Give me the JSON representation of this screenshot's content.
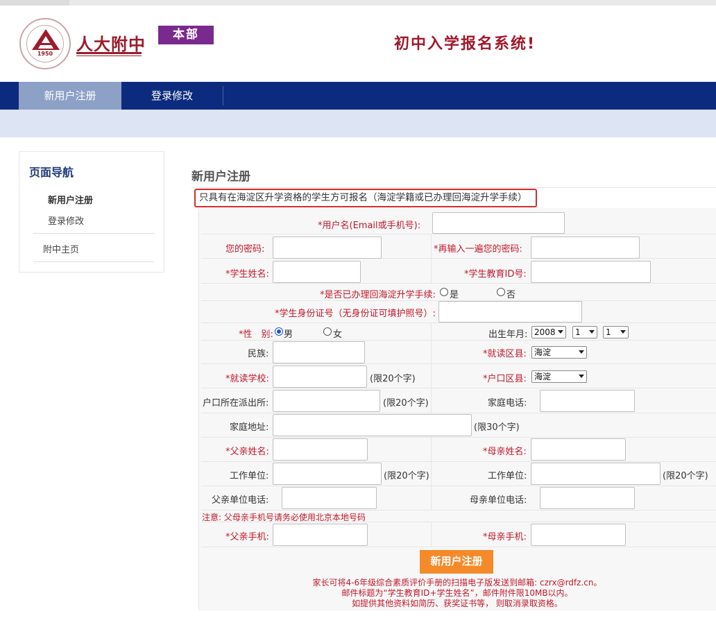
{
  "header": {
    "school_name": "人大附中",
    "seal_year": "1950",
    "campus": "本部",
    "site_title": "初中入学报名系统!"
  },
  "nav": {
    "tabs": [
      {
        "label": "新用户注册",
        "active": true
      },
      {
        "label": "登录修改",
        "active": false
      }
    ]
  },
  "sidebar": {
    "title": "页面导航",
    "items": [
      "新用户注册",
      "登录修改",
      "附中主页"
    ]
  },
  "main": {
    "title": "新用户注册",
    "notice": "只具有在海淀区升学资格的学生方可报名（海淀学籍或已办理回海淀升学手续）"
  },
  "form": {
    "username_label": "*用户名(Email或手机号):",
    "password_label": "您的密码:",
    "password2_label": "*再输入一遍您的密码:",
    "student_name_label": "*学生姓名:",
    "student_id_label": "*学生教育ID号:",
    "transfer_label": "*是否已办理回海淀升学手续:",
    "transfer_yes": "是",
    "transfer_no": "否",
    "idcard_label": "*学生身份证号（无身份证可填护照号）:",
    "gender_label": "*性　别:",
    "gender_male": "男",
    "gender_female": "女",
    "birth_label": "出生年月:",
    "birth_year": "2008",
    "birth_month": "1",
    "birth_day": "1",
    "ethnicity_label": "民族:",
    "district_label": "*就读区县:",
    "district_value": "海淀",
    "school_label": "*就读学校:",
    "limit20": "(限20个字)",
    "hukou_label": "*户口区县:",
    "hukou_value": "海淀",
    "police_label": "户口所在派出所:",
    "home_phone_label": "家庭电话:",
    "address_label": "家庭地址:",
    "limit30": "(限30个字)",
    "father_name_label": "*父亲姓名:",
    "mother_name_label": "*母亲姓名:",
    "work_label": "工作单位:",
    "father_work_phone_label": "父亲单位电话:",
    "mother_work_phone_label": "母亲单位电话:",
    "mobile_note": "注意: 父母亲手机号请务必使用北京本地号码",
    "father_mobile_label": "*父亲手机:",
    "mother_mobile_label": "*母亲手机:",
    "submit_label": "新用户注册"
  },
  "footer": {
    "line1": "家长可将4-6年级综合素质评价手册的扫描电子版发送到邮箱: czrx@rdfz.cn。",
    "line2": "邮件标题为“学生教育ID+学生姓名”，邮件附件限10MB以内。",
    "line3": "如提供其他资料如简历、获奖证书等， 则取消录取资格。"
  },
  "colors": {
    "nav_bg": "#0d2b7e",
    "nav_active": "#8da0c6",
    "brand_red": "#9c1c2b",
    "campus_purple": "#7a2a8e",
    "submit_orange": "#f58a2a"
  }
}
